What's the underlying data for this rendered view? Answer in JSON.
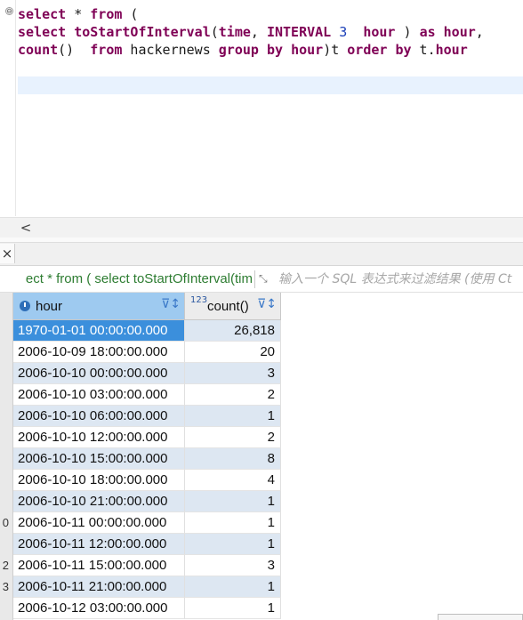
{
  "editor": {
    "lines": [
      [
        {
          "t": "select",
          "k": "kw"
        },
        {
          "t": " * ",
          "k": ""
        },
        {
          "t": "from",
          "k": "kw"
        },
        {
          "t": " (",
          "k": ""
        }
      ],
      [
        {
          "t": "select",
          "k": "kw"
        },
        {
          "t": " ",
          "k": ""
        },
        {
          "t": "toStartOfInterval",
          "k": "kw"
        },
        {
          "t": "(",
          "k": ""
        },
        {
          "t": "time",
          "k": "kw"
        },
        {
          "t": ", ",
          "k": ""
        },
        {
          "t": "INTERVAL",
          "k": "kw"
        },
        {
          "t": " ",
          "k": ""
        },
        {
          "t": "3",
          "k": "num"
        },
        {
          "t": "  ",
          "k": ""
        },
        {
          "t": "hour",
          "k": "kw"
        },
        {
          "t": " ) ",
          "k": ""
        },
        {
          "t": "as",
          "k": "kw"
        },
        {
          "t": " ",
          "k": ""
        },
        {
          "t": "hour",
          "k": "kw"
        },
        {
          "t": ",",
          "k": ""
        }
      ],
      [
        {
          "t": "count",
          "k": "kw"
        },
        {
          "t": "()  ",
          "k": ""
        },
        {
          "t": "from",
          "k": "kw"
        },
        {
          "t": " hackernews ",
          "k": ""
        },
        {
          "t": "group",
          "k": "kw"
        },
        {
          "t": " ",
          "k": ""
        },
        {
          "t": "by",
          "k": "kw"
        },
        {
          "t": " ",
          "k": ""
        },
        {
          "t": "hour",
          "k": "kw"
        },
        {
          "t": ")t ",
          "k": ""
        },
        {
          "t": "order",
          "k": "kw"
        },
        {
          "t": " ",
          "k": ""
        },
        {
          "t": "by",
          "k": "kw"
        },
        {
          "t": " t.",
          "k": ""
        },
        {
          "t": "hour",
          "k": "kw"
        }
      ]
    ],
    "fold_glyph": "⊖"
  },
  "scrollbar": {
    "left_arrow": "<"
  },
  "tabstrip": {
    "close_glyph": "×"
  },
  "filter": {
    "query_text": "ect * from ( select toStartOfInterval(tim",
    "expand_glyph": "⤡",
    "placeholder": "输入一个 SQL 表达式来过滤结果 (使用 Ct"
  },
  "grid": {
    "columns": [
      {
        "label": "hour",
        "type_icon": "clock-icon",
        "filter_glyph": "⊽↕"
      },
      {
        "label": "count()",
        "type_icon": "123",
        "filter_glyph": "⊽↕"
      }
    ],
    "row_numbers": [
      "",
      "",
      "",
      "",
      "",
      "",
      "",
      "",
      "",
      "0",
      "",
      "2",
      "3",
      ""
    ],
    "rows": [
      {
        "hour": "1970-01-01 00:00:00.000",
        "count": "26,818"
      },
      {
        "hour": "2006-10-09 18:00:00.000",
        "count": "20"
      },
      {
        "hour": "2006-10-10 00:00:00.000",
        "count": "3"
      },
      {
        "hour": "2006-10-10 03:00:00.000",
        "count": "2"
      },
      {
        "hour": "2006-10-10 06:00:00.000",
        "count": "1"
      },
      {
        "hour": "2006-10-10 12:00:00.000",
        "count": "2"
      },
      {
        "hour": "2006-10-10 15:00:00.000",
        "count": "8"
      },
      {
        "hour": "2006-10-10 18:00:00.000",
        "count": "4"
      },
      {
        "hour": "2006-10-10 21:00:00.000",
        "count": "1"
      },
      {
        "hour": "2006-10-11 00:00:00.000",
        "count": "1"
      },
      {
        "hour": "2006-10-11 12:00:00.000",
        "count": "1"
      },
      {
        "hour": "2006-10-11 15:00:00.000",
        "count": "3"
      },
      {
        "hour": "2006-10-11 21:00:00.000",
        "count": "1"
      },
      {
        "hour": "2006-10-12 03:00:00.000",
        "count": "1"
      }
    ],
    "selected_row": 0
  },
  "colors": {
    "keyword": "#7f0055",
    "number": "#1a3fb8",
    "query_green": "#2e7d32",
    "selection_blue": "#3b8fdc",
    "header_blue": "#9ecaf0",
    "alt_row": "#dde7f2"
  }
}
